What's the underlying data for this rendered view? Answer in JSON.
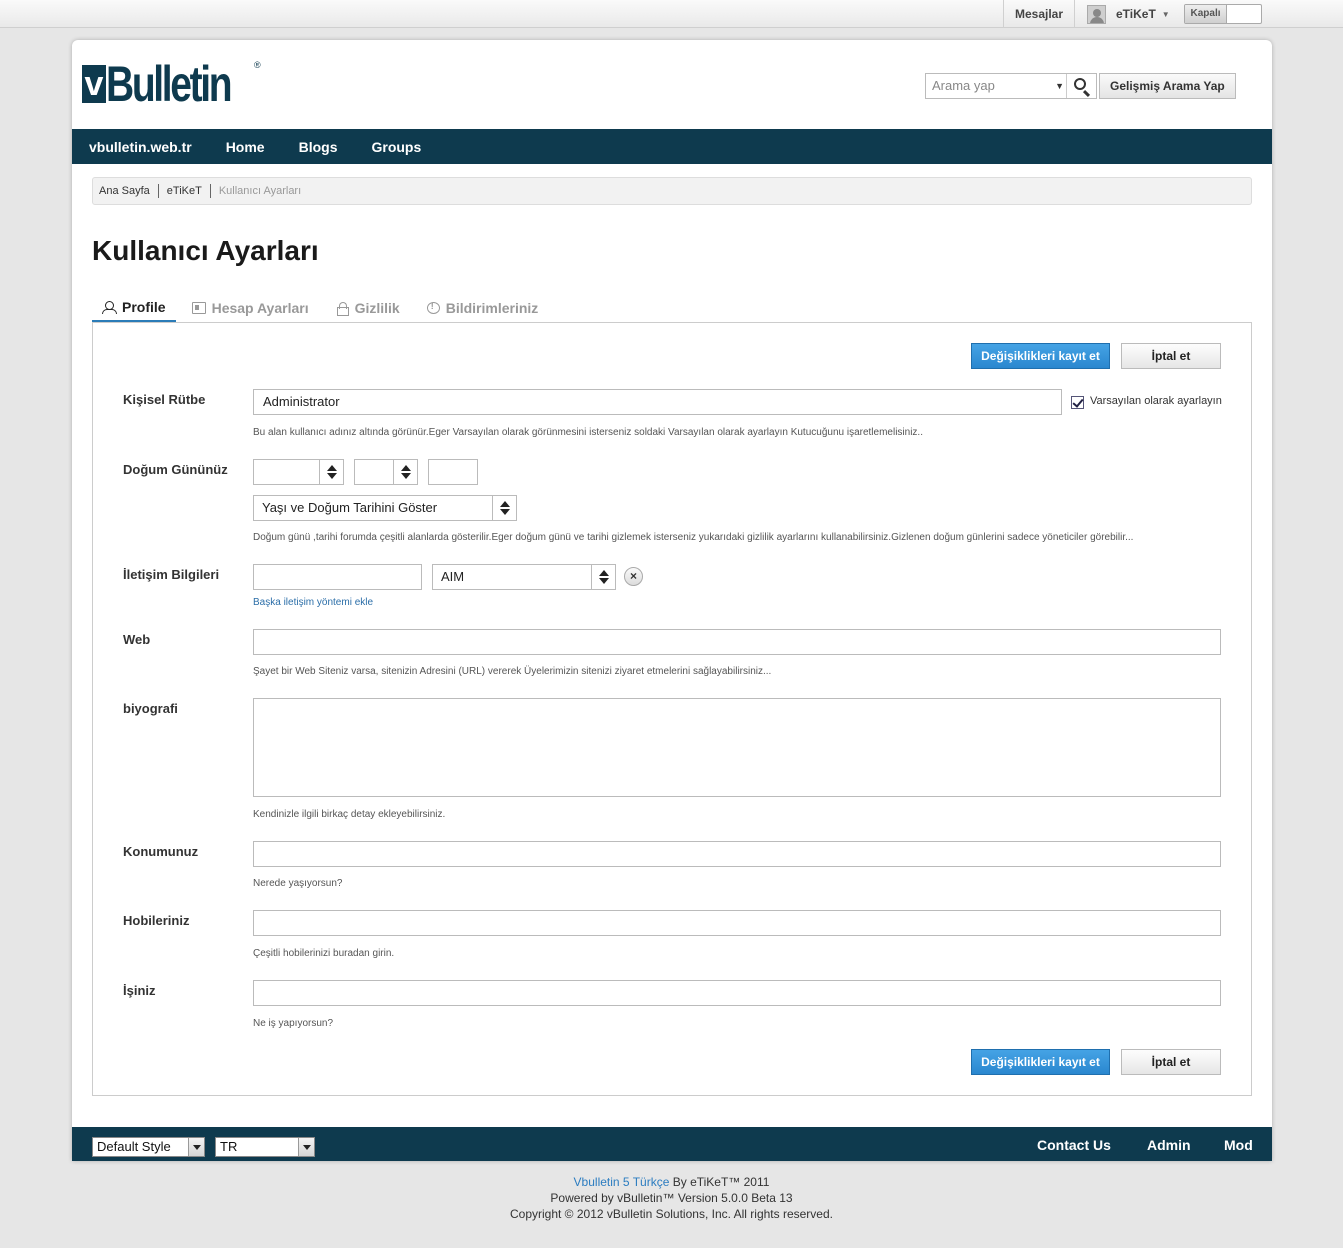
{
  "topbar": {
    "messages": "Mesajlar",
    "username": "eTiKeT",
    "toggle_label": "Kapalı"
  },
  "header": {
    "logo_text": "Bulletin",
    "logo_mark": "v",
    "search_placeholder": "Arama yap",
    "advanced_search": "Gelişmiş Arama Yap"
  },
  "nav": {
    "items": [
      "vbulletin.web.tr",
      "Home",
      "Blogs",
      "Groups"
    ]
  },
  "breadcrumb": [
    "Ana Sayfa",
    "eTiKeT",
    "Kullanıcı Ayarları"
  ],
  "page_title": "Kullanıcı Ayarları",
  "tabs": [
    {
      "label": "Profile",
      "icon": "person-icon",
      "active": true
    },
    {
      "label": "Hesap Ayarları",
      "icon": "id-card-icon",
      "active": false
    },
    {
      "label": "Gizlilik",
      "icon": "lock-icon",
      "active": false
    },
    {
      "label": "Bildirimleriniz",
      "icon": "notification-icon",
      "active": false
    }
  ],
  "buttons": {
    "save": "Değişiklikleri kayıt et",
    "cancel": "İptal et"
  },
  "form": {
    "rank": {
      "label": "Kişisel Rütbe",
      "value": "Administrator",
      "checkbox_label": "Varsayılan olarak ayarlayın",
      "checked": true,
      "hint": "Bu alan kullanıcı adınız altında görünür.Eger Varsayılan olarak görünmesini isterseniz soldaki Varsayılan olarak ayarlayın Kutucuğunu işaretlemelisiniz.."
    },
    "birthday": {
      "label": "Doğum Gününüz",
      "display_option": "Yaşı ve Doğum Tarihini Göster",
      "hint": "Doğum günü ,tarihi forumda çeşitli alanlarda gösterilir.Eger doğum günü ve tarihi gizlemek isterseniz yukarıdaki gizlilik ayarlarını kullanabilirsiniz.Gizlenen doğum günlerini sadece yöneticiler görebilir..."
    },
    "contact": {
      "label": "İletişim Bilgileri",
      "type": "AIM",
      "add_link": "Başka iletişim yöntemi ekle"
    },
    "web": {
      "label": "Web",
      "hint": "Şayet bir Web Siteniz varsa, sitenizin Adresini (URL) vererek Üyelerimizin sitenizi ziyaret etmelerini sağlayabilirsiniz..."
    },
    "bio": {
      "label": "biyografi",
      "hint": "Kendinizle ilgili birkaç detay ekleyebilirsiniz."
    },
    "location": {
      "label": "Konumunuz",
      "hint": "Nerede yaşıyorsun?"
    },
    "hobbies": {
      "label": "Hobileriniz",
      "hint": "Çeşitli hobilerinizi buradan girin."
    },
    "job": {
      "label": "İşiniz",
      "hint": "Ne iş yapıyorsun?"
    }
  },
  "footer": {
    "style_select": "Default Style",
    "lang_select": "TR",
    "links": [
      "Contact Us",
      "Admin",
      "Mod"
    ],
    "credit_link": "Vbulletin 5 Türkçe",
    "credit_by": " By eTiKeT™ 2011",
    "powered": "Powered by vBulletin™ Version 5.0.0 Beta 13",
    "copyright": "Copyright © 2012 vBulletin Solutions, Inc. All rights reserved."
  },
  "colors": {
    "nav_bg": "#0e3a4e",
    "accent_blue": "#2a87cf",
    "tab_underline": "#2b7cb8"
  }
}
